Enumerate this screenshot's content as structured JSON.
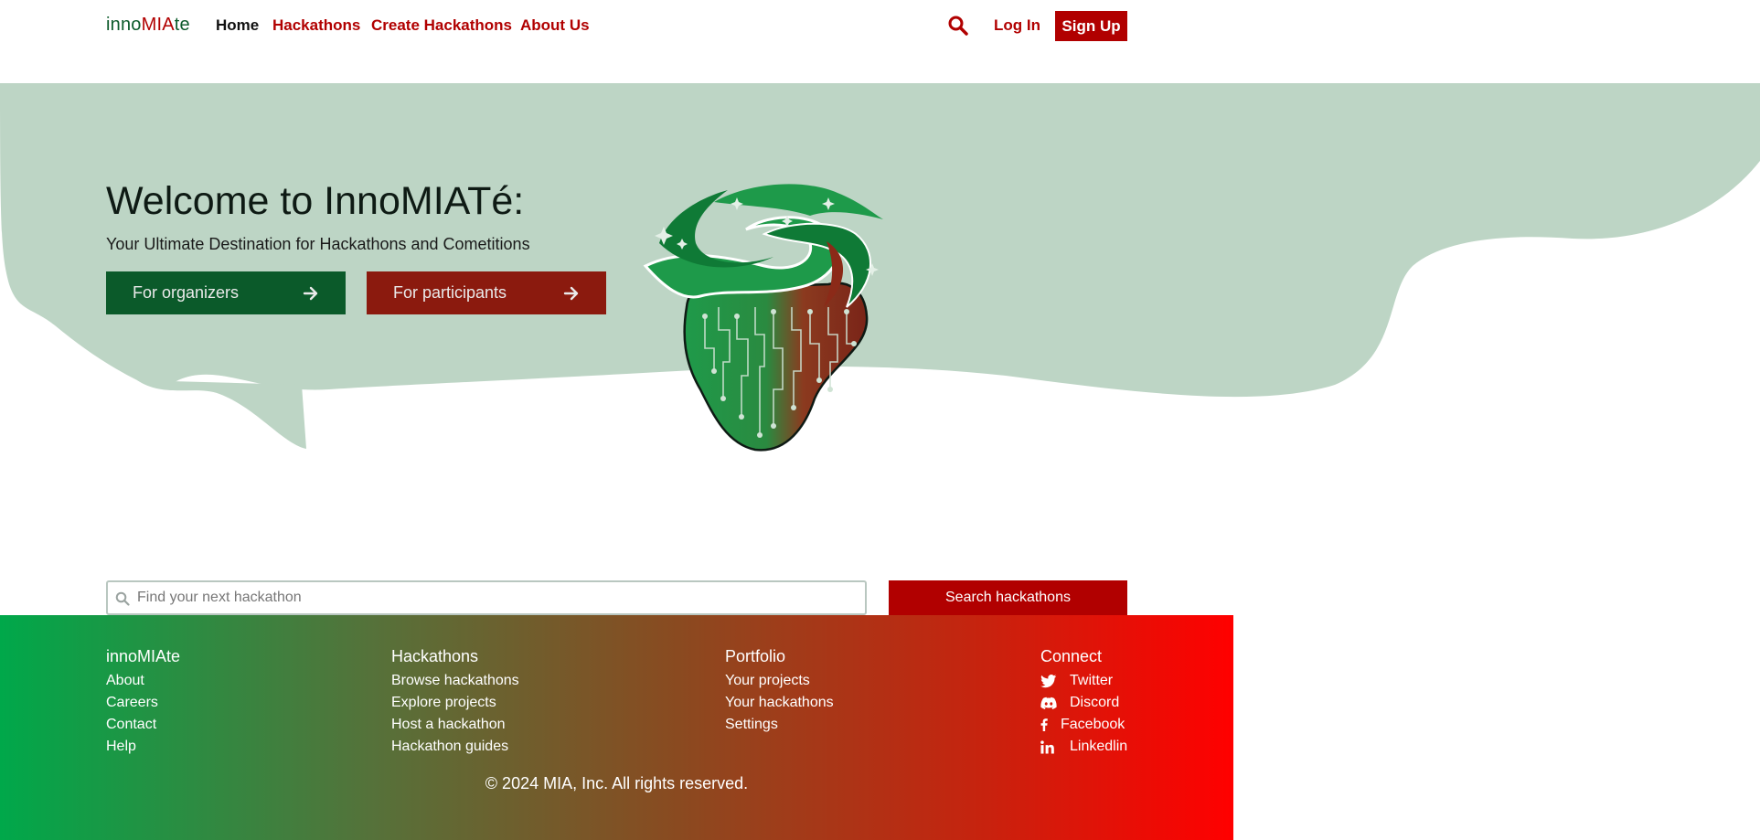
{
  "nav": {
    "logo_part1": "inno",
    "logo_part2": "MIA",
    "logo_part3": "te",
    "links": [
      "Home",
      "Hackathons",
      "Create Hackathons",
      "About Us"
    ],
    "login": "Log In",
    "signup": "Sign Up"
  },
  "hero": {
    "title": "Welcome to InnoMIATé:",
    "subtitle": "Your Ultimate Destination for Hackathons and Cometitions",
    "cta_organizers": "For organizers",
    "cta_participants": "For participants"
  },
  "search": {
    "placeholder": "Find your next hackathon",
    "button": "Search hackathons"
  },
  "footer": {
    "columns": [
      {
        "title": "innoMIAte",
        "links": [
          "About",
          "Careers",
          "Contact",
          "Help"
        ]
      },
      {
        "title": "Hackathons",
        "links": [
          "Browse hackathons",
          "Explore projects",
          "Host a hackathon",
          "Hackathon guides"
        ]
      },
      {
        "title": "Portfolio",
        "links": [
          "Your projects",
          "Your hackathons",
          "Settings"
        ]
      },
      {
        "title": "Connect",
        "links": [
          "Twitter",
          "Discord",
          "Facebook",
          "Linkedlin"
        ]
      }
    ],
    "social_icons": [
      "twitter-icon",
      "discord-icon",
      "facebook-icon",
      "linkedin-icon"
    ],
    "copyright": "© 2024 MIA, Inc. All rights reserved."
  },
  "colors": {
    "brand_red": "#b10000",
    "brand_green": "#0b5a2a",
    "hero_bg": "#bdd5c5",
    "participants_btn": "#8b1a0e"
  }
}
